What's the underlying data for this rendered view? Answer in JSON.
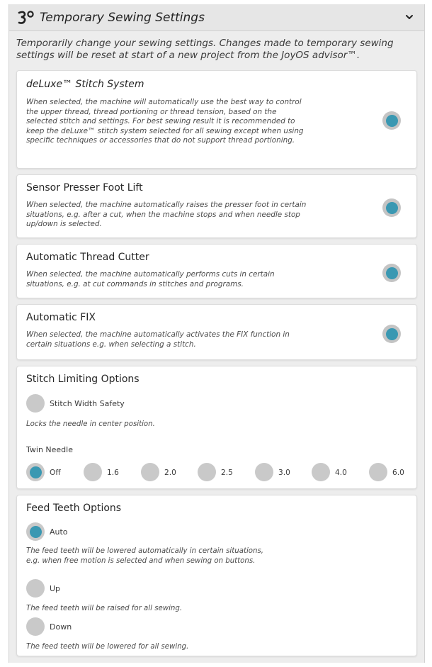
{
  "header": {
    "title": "Temporary Sewing Settings",
    "logo_icon": "joyos-logo-icon",
    "chevron_icon": "chevron-down-icon"
  },
  "intro": "Temporarily change your sewing settings. Changes made to temporary sewing settings will be reset at start of a new project from the JoyOS advisor™.",
  "colors": {
    "accent": "#3a98b2",
    "toggle_ring": "#c4c4c4",
    "panel": "#ededed",
    "card": "#ffffff"
  },
  "deluxe": {
    "title": "deLuxe™ Stitch System",
    "desc": "When selected, the machine will automatically use the best way to control the upper thread, thread portioning or thread tension, based on the selected stitch and settings. For best sewing result it is recommended to keep the deLuxe™ stitch system selected for all sewing except when using specific techniques or accessories that do not support thread portioning.",
    "enabled": true
  },
  "sensor_foot": {
    "title": "Sensor Presser Foot Lift",
    "desc": "When selected, the machine automatically raises the presser foot in certain situations, e.g. after a cut, when the machine stops and when needle stop up/down is selected.",
    "enabled": true
  },
  "thread_cutter": {
    "title": "Automatic Thread Cutter",
    "desc": "When selected, the machine automatically performs cuts in certain situations, e.g. at cut commands in stitches and programs.",
    "enabled": true
  },
  "auto_fix": {
    "title": "Automatic FIX",
    "desc": "When selected, the machine automatically activates the FIX function in certain situations e.g. when selecting a stitch.",
    "enabled": true
  },
  "stitch_limiting": {
    "title": "Stitch Limiting Options",
    "width_safety_label": "Stitch Width Safety",
    "width_safety_desc": "Locks the needle in center position.",
    "width_safety_selected": false,
    "twin_label": "Twin Needle",
    "twin_options": [
      "Off",
      "1.6",
      "2.0",
      "2.5",
      "3.0",
      "4.0",
      "6.0"
    ],
    "twin_selected": "Off"
  },
  "feed_teeth": {
    "title": "Feed Teeth Options",
    "selected": "Auto",
    "options": [
      {
        "label": "Auto",
        "desc": "The feed teeth will be lowered automatically in certain situations, e.g. when free motion is selected and when sewing on buttons."
      },
      {
        "label": "Up",
        "desc": "The feed teeth will be raised for all sewing."
      },
      {
        "label": "Down",
        "desc": "The feed teeth will be lowered for all sewing."
      }
    ]
  }
}
